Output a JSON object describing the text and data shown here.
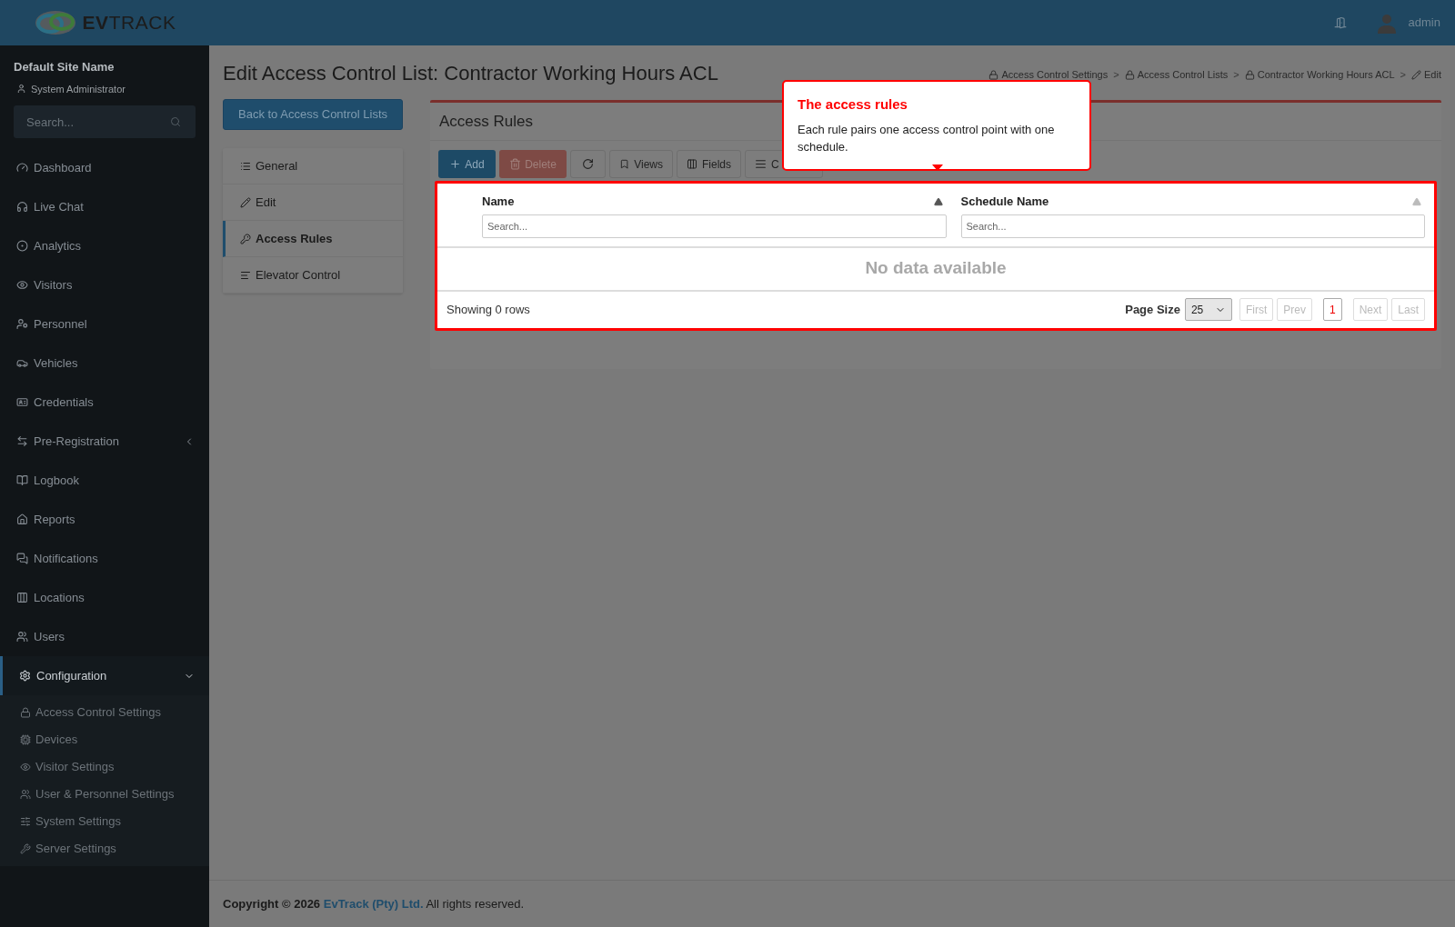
{
  "header": {
    "logo": {
      "bold": "EV",
      "light": "TRACK"
    },
    "user": "admin"
  },
  "sidebar": {
    "site_name": "Default Site Name",
    "role": "System Administrator",
    "search": {
      "placeholder": "Search..."
    },
    "items": [
      {
        "label": "Dashboard",
        "selected": false
      },
      {
        "label": "Live Chat",
        "selected": false
      },
      {
        "label": "Analytics",
        "selected": false
      },
      {
        "label": "Visitors",
        "selected": false
      },
      {
        "label": "Personnel",
        "selected": false
      },
      {
        "label": "Vehicles",
        "selected": false
      },
      {
        "label": "Credentials",
        "selected": false
      },
      {
        "label": "Pre-Registration",
        "selected": false,
        "expanded": false
      },
      {
        "label": "Logbook",
        "selected": false
      },
      {
        "label": "Reports",
        "selected": false
      },
      {
        "label": "Notifications",
        "selected": false
      },
      {
        "label": "Locations",
        "selected": false
      },
      {
        "label": "Users",
        "selected": false
      },
      {
        "label": "Configuration",
        "selected": true,
        "expanded": true,
        "children": [
          {
            "label": "Access Control Settings"
          },
          {
            "label": "Devices"
          },
          {
            "label": "Visitor Settings"
          },
          {
            "label": "User & Personnel Settings"
          },
          {
            "label": "System Settings"
          },
          {
            "label": "Server Settings"
          }
        ]
      }
    ]
  },
  "page": {
    "title": "Edit Access Control List: Contractor Working Hours ACL",
    "breadcrumb_separator": ">",
    "breadcrumbs": [
      {
        "label": "Access Control Settings",
        "kind": "lock"
      },
      {
        "label": "Access Control Lists",
        "kind": "lock"
      },
      {
        "label": "Contractor Working Hours ACL",
        "kind": "lock"
      },
      {
        "label": "Edit",
        "kind": "pencil"
      }
    ],
    "back_button": "Back to Access Control Lists",
    "tabs": [
      {
        "label": "General",
        "selected": false
      },
      {
        "label": "Edit",
        "selected": false
      },
      {
        "label": "Access Rules",
        "selected": true
      },
      {
        "label": "Elevator Control",
        "selected": false
      }
    ]
  },
  "panel": {
    "title": "Access Rules",
    "toolbar": [
      {
        "kind": "primary",
        "label": "Add"
      },
      {
        "kind": "danger",
        "label": "Delete"
      },
      {
        "kind": "refresh"
      },
      {
        "kind": "default",
        "label": "Views"
      },
      {
        "kind": "default",
        "label": "Fields"
      },
      {
        "kind": "default",
        "label": "C"
      }
    ],
    "table": {
      "columns": [
        {
          "label": "Name",
          "sorted": true,
          "placeholder": "Search..."
        },
        {
          "label": "Schedule Name",
          "sorted": false,
          "placeholder": "Search..."
        }
      ],
      "empty_message": "No data available",
      "summary": "Showing 0 rows",
      "page_size_label": "Page Size",
      "page_size": "25",
      "pager": [
        {
          "label": "First",
          "disabled": true,
          "selected": false
        },
        {
          "label": "Prev",
          "disabled": true,
          "selected": false
        },
        {
          "label": "1",
          "disabled": false,
          "selected": true
        },
        {
          "label": "Next",
          "disabled": true,
          "selected": false
        },
        {
          "label": "Last",
          "disabled": true,
          "selected": false
        }
      ]
    }
  },
  "tooltip": {
    "title": "The access rules",
    "body": "Each rule pairs one access control point with one schedule."
  },
  "footer": {
    "text": "**Copyright © 2026**",
    "link": "EvTrack (Pty) Ltd.",
    "rest": "All rights reserved."
  }
}
